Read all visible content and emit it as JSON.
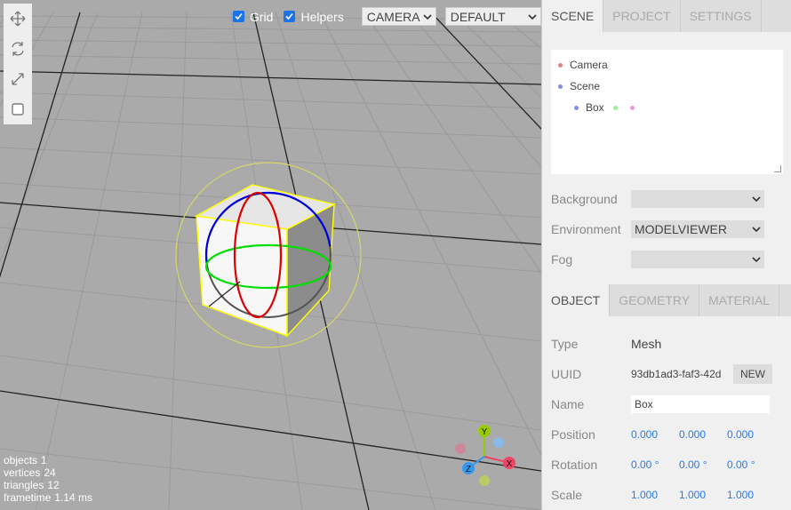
{
  "toolbar": {
    "items": [
      {
        "name": "translate-icon"
      },
      {
        "name": "rotate-icon"
      },
      {
        "name": "scale-icon"
      },
      {
        "name": "local-toggle-icon"
      }
    ]
  },
  "top_menu": {
    "grid_label": "Grid",
    "helpers_label": "Helpers",
    "camera_select": "CAMERA",
    "shading_select": "DEFAULT"
  },
  "info": {
    "objects_label": "objects",
    "objects_value": "1",
    "vertices_label": "vertices",
    "vertices_value": "24",
    "triangles_label": "triangles",
    "triangles_value": "12",
    "frametime_label": "frametime",
    "frametime_value": "1.14 ms"
  },
  "gizmo": {
    "x_label": "X",
    "y_label": "Y",
    "z_label": "Z"
  },
  "sidebar": {
    "tabs": [
      "SCENE",
      "PROJECT",
      "SETTINGS"
    ],
    "outliner": [
      {
        "label": "Camera",
        "color": "#dd8888"
      },
      {
        "label": "Scene",
        "color": "#8888dd"
      },
      {
        "label": "Box",
        "color": "#8888ee"
      }
    ],
    "background_label": "Background",
    "background_value": "",
    "environment_label": "Environment",
    "environment_value": "MODELVIEWER",
    "fog_label": "Fog",
    "fog_value": ""
  },
  "object_panel": {
    "tabs": [
      "OBJECT",
      "GEOMETRY",
      "MATERIAL"
    ],
    "type_label": "Type",
    "type_value": "Mesh",
    "uuid_label": "UUID",
    "uuid_value": "93db1ad3-faf3-42d",
    "new_button": "NEW",
    "name_label": "Name",
    "name_value": "Box",
    "position_label": "Position",
    "position": [
      "0.000",
      "0.000",
      "0.000"
    ],
    "rotation_label": "Rotation",
    "rotation": [
      "0.00 °",
      "0.00 °",
      "0.00 °"
    ],
    "scale_label": "Scale",
    "scale": [
      "1.000",
      "1.000",
      "1.000"
    ]
  }
}
